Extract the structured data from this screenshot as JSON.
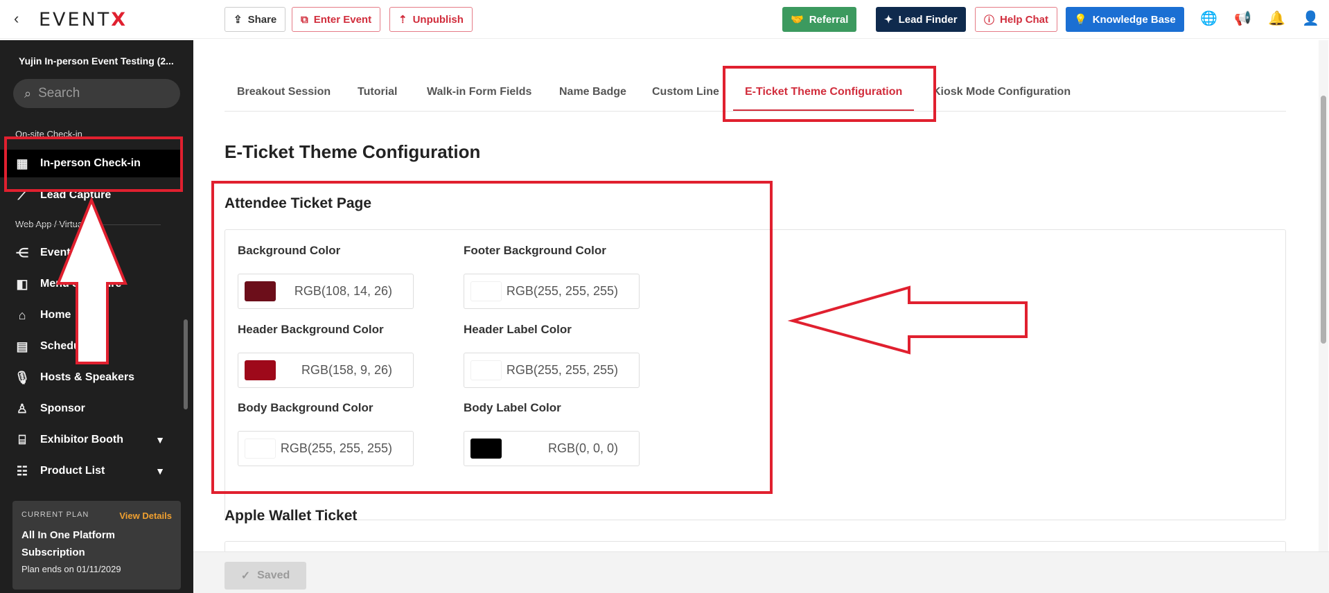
{
  "topbar": {
    "logo": "EVENTX",
    "share": "Share",
    "enter_event": "Enter Event",
    "unpublish": "Unpublish",
    "referral": "Referral",
    "lead_finder": "Lead Finder",
    "help_chat": "Help Chat",
    "knowledge_base": "Knowledge Base"
  },
  "sidebar": {
    "event_name": "Yujin In-person Event Testing (2...",
    "search_placeholder": "Search",
    "section_onsite": "On-site Check-in",
    "section_webapp": "Web App / Virtual",
    "items": [
      {
        "label": "In-person Check-in",
        "icon": "qr-code-icon"
      },
      {
        "label": "Lead Capture",
        "icon": "lead-capture-icon"
      },
      {
        "label": "Event",
        "icon": "share-nodes-icon"
      },
      {
        "label": "Menu Structure",
        "icon": "menu-panel-icon"
      },
      {
        "label": "Home",
        "icon": "home-icon"
      },
      {
        "label": "Schedule",
        "icon": "calendar-icon"
      },
      {
        "label": "Hosts & Speakers",
        "icon": "microphone-icon"
      },
      {
        "label": "Sponsor",
        "icon": "sponsor-icon"
      },
      {
        "label": "Exhibitor Booth",
        "icon": "booth-icon"
      },
      {
        "label": "Product List",
        "icon": "list-icon"
      }
    ],
    "plan": {
      "label": "CURRENT PLAN",
      "view_details": "View Details",
      "name": "All In One Platform Subscription",
      "ends": "Plan ends on 01/11/2029"
    }
  },
  "tabs": [
    "Breakout Session",
    "Tutorial",
    "Walk-in Form Fields",
    "Name Badge",
    "Custom Line",
    "E-Ticket Theme Configuration",
    "Kiosk Mode Configuration"
  ],
  "page_title": "E-Ticket Theme Configuration",
  "attendee_section": {
    "title": "Attendee Ticket Page",
    "fields": [
      {
        "label": "Background Color",
        "value": "RGB(108, 14, 26)",
        "color": "#6c0e1a"
      },
      {
        "label": "Footer Background Color",
        "value": "RGB(255, 255, 255)",
        "color": "#ffffff"
      },
      {
        "label": "Header Background Color",
        "value": "RGB(158, 9, 26)",
        "color": "#9e091a"
      },
      {
        "label": "Header Label Color",
        "value": "RGB(255, 255, 255)",
        "color": "#ffffff"
      },
      {
        "label": "Body Background Color",
        "value": "RGB(255, 255, 255)",
        "color": "#ffffff"
      },
      {
        "label": "Body Label Color",
        "value": "RGB(0, 0, 0)",
        "color": "#000000"
      }
    ]
  },
  "apple_section": {
    "title": "Apple Wallet Ticket"
  },
  "save_button": "Saved",
  "colors": {
    "accent": "#d12d3c",
    "annotation": "#e0202f",
    "sidebar": "#1f1f1f"
  }
}
